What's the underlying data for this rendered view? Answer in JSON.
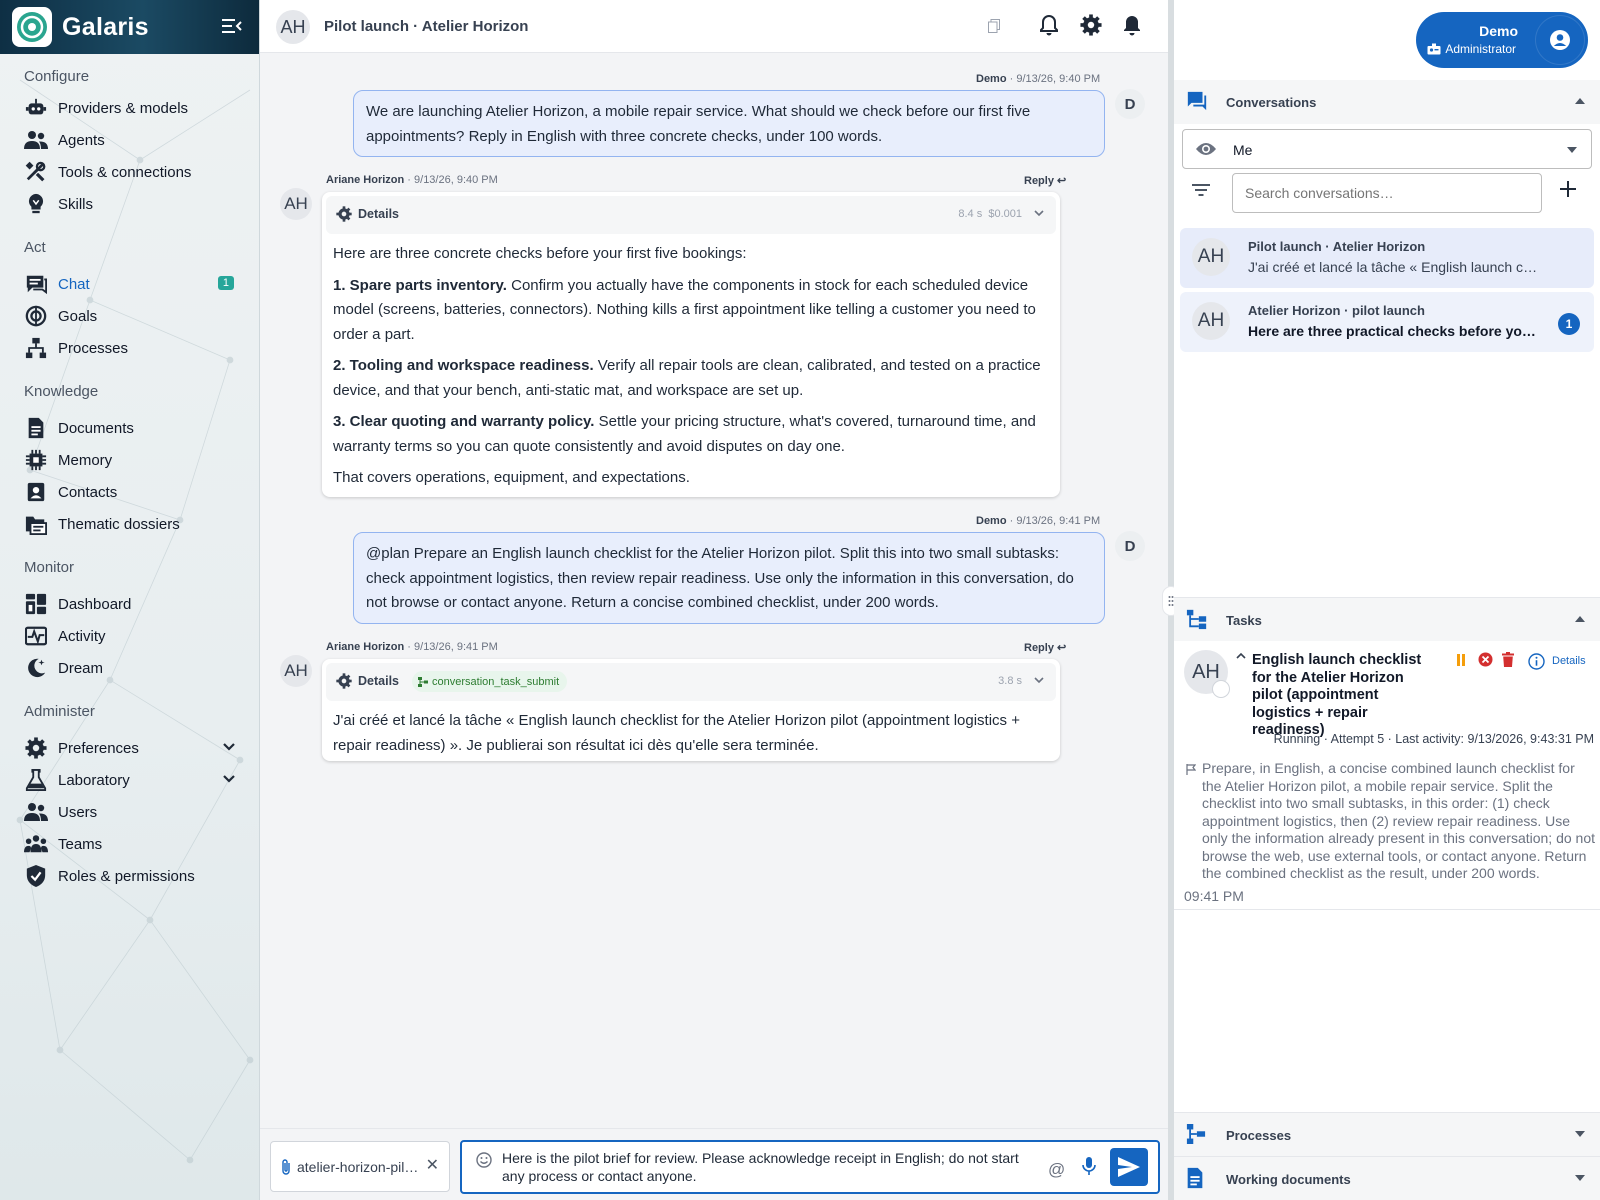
{
  "app": {
    "name": "Galaris"
  },
  "sidebar": {
    "sections": [
      {
        "title": "Configure",
        "items": [
          {
            "label": "Providers & models",
            "icon": "robot-icon"
          },
          {
            "label": "Agents",
            "icon": "people-icon"
          },
          {
            "label": "Tools & connections",
            "icon": "tools-icon"
          },
          {
            "label": "Skills",
            "icon": "lightbulb-icon"
          }
        ]
      },
      {
        "title": "Act",
        "items": [
          {
            "label": "Chat",
            "icon": "chat-icon",
            "active": true,
            "badge": "1"
          },
          {
            "label": "Goals",
            "icon": "target-icon"
          },
          {
            "label": "Processes",
            "icon": "flow-icon"
          }
        ]
      },
      {
        "title": "Knowledge",
        "items": [
          {
            "label": "Documents",
            "icon": "document-icon"
          },
          {
            "label": "Memory",
            "icon": "chip-icon"
          },
          {
            "label": "Contacts",
            "icon": "contact-icon"
          },
          {
            "label": "Thematic dossiers",
            "icon": "folder-icon"
          }
        ]
      },
      {
        "title": "Monitor",
        "items": [
          {
            "label": "Dashboard",
            "icon": "dashboard-icon"
          },
          {
            "label": "Activity",
            "icon": "activity-icon"
          },
          {
            "label": "Dream",
            "icon": "moon-icon"
          }
        ]
      },
      {
        "title": "Administer",
        "items": [
          {
            "label": "Preferences",
            "icon": "gear-icon",
            "expandable": true
          },
          {
            "label": "Laboratory",
            "icon": "flask-icon",
            "expandable": true
          },
          {
            "label": "Users",
            "icon": "people-icon"
          },
          {
            "label": "Teams",
            "icon": "team-icon"
          },
          {
            "label": "Roles & permissions",
            "icon": "shield-icon"
          }
        ]
      }
    ]
  },
  "header": {
    "avatar": "AH",
    "title": "Pilot launch · Atelier Horizon"
  },
  "messages": {
    "m1": {
      "author": "Demo",
      "time": "9/13/26, 9:40 PM",
      "avatar": "D",
      "text": "We are launching Atelier Horizon, a mobile repair service. What should we check before our first five appointments? Reply in English with three concrete checks, under 100 words."
    },
    "m2": {
      "author": "Ariane Horizon",
      "time": "9/13/26, 9:40 PM",
      "avatar": "AH",
      "reply": "Reply",
      "details": "Details",
      "duration": "8.4 s",
      "cost": "$0.001",
      "intro": "Here are three concrete checks before your first five bookings:",
      "points": [
        {
          "head": "1. Spare parts inventory.",
          "text": " Confirm you actually have the components in stock for each scheduled device model (screens, batteries, connectors). Nothing kills a first appointment like telling a customer you need to order a part."
        },
        {
          "head": "2. Tooling and workspace readiness.",
          "text": " Verify all repair tools are clean, calibrated, and tested on a practice device, and that your bench, anti-static mat, and workspace are set up."
        },
        {
          "head": "3. Clear quoting and warranty policy.",
          "text": " Settle your pricing structure, what's covered, turnaround time, and warranty terms so you can quote consistently and avoid disputes on day one."
        }
      ],
      "outro": "That covers operations, equipment, and expectations."
    },
    "m3": {
      "author": "Demo",
      "time": "9/13/26, 9:41 PM",
      "avatar": "D",
      "text": "@plan Prepare an English launch checklist for the Atelier Horizon pilot. Split this into two small subtasks: check appointment logistics, then review repair readiness. Use only the information in this conversation, do not browse or contact anyone. Return a concise combined checklist, under 200 words."
    },
    "m4": {
      "author": "Ariane Horizon",
      "time": "9/13/26, 9:41 PM",
      "avatar": "AH",
      "reply": "Reply",
      "details": "Details",
      "tool": "conversation_task_submit",
      "duration": "3.8 s",
      "text": "J'ai créé et lancé la tâche « English launch checklist for the Atelier Horizon pilot (appointment logistics + repair readiness) ». Je publierai son résultat ici dès qu'elle sera terminée."
    }
  },
  "composer": {
    "attachment": "atelier-horizon-pilot-brief",
    "text": "Here is the pilot brief for review. Please acknowledge receipt in English; do not start any process or contact anyone.",
    "at": "@"
  },
  "user": {
    "name": "Demo",
    "role": "Administrator"
  },
  "conversations": {
    "title": "Conversations",
    "filter_value": "Me",
    "search_placeholder": "Search conversations…",
    "items": [
      {
        "avatar": "AH",
        "title": "Pilot launch · Atelier Horizon",
        "preview": "J'ai créé et lancé la tâche « English launch checklist for the Atelier Horizon pilot »"
      },
      {
        "avatar": "AH",
        "title": "Atelier Horizon · pilot launch",
        "preview": "Here are three practical checks before your first five appointments",
        "badge": "1"
      }
    ]
  },
  "tasks": {
    "title": "Tasks",
    "item": {
      "avatar": "AH",
      "title": "English launch checklist for the Atelier Horizon pilot (appointment logistics + repair readiness)",
      "details": "Details",
      "status": "Running · Attempt 5 · Last activity: 9/13/2026, 9:43:31 PM",
      "description": "Prepare, in English, a concise combined launch checklist for the Atelier Horizon pilot, a mobile repair service. Split the checklist into two small subtasks, in this order: (1) check appointment logistics, then (2) review repair readiness. Use only the information already present in this conversation; do not browse the web, use external tools, or contact anyone. Return the combined checklist as the result, under 200 words.",
      "time": "09:41 PM"
    }
  },
  "processes": {
    "title": "Processes"
  },
  "working_documents": {
    "title": "Working documents"
  },
  "colors": {
    "accent": "#1565c0",
    "badge": "#26a69a",
    "user_bubble": "#e8eefc",
    "pause": "#f59e0b",
    "danger": "#d32f2f"
  }
}
